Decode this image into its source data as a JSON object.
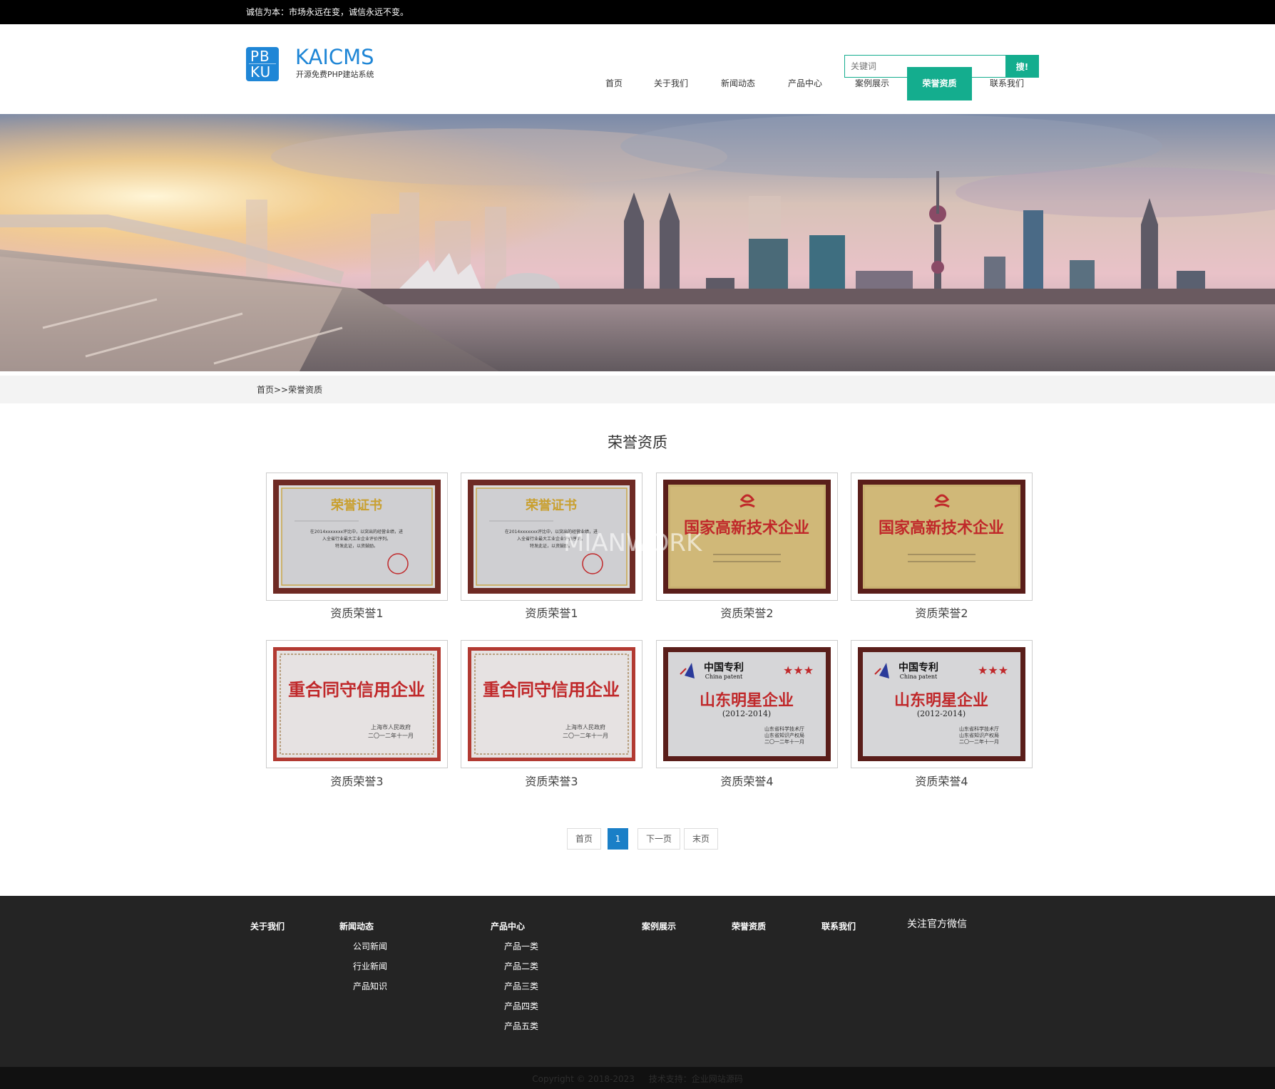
{
  "topbar": {
    "slogan": "诚信为本：市场永远在变，诚信永远不变。"
  },
  "logo": {
    "mark_line1": "PB",
    "mark_line2": "KU",
    "name": "KAICMS",
    "tagline": "开源免费PHP建站系统",
    "brand_color": "#1f86d6"
  },
  "search": {
    "placeholder": "关键词",
    "button_label": "搜!"
  },
  "nav": {
    "items": [
      {
        "label": "首页",
        "active": false
      },
      {
        "label": "关于我们",
        "active": false
      },
      {
        "label": "新闻动态",
        "active": false
      },
      {
        "label": "产品中心",
        "active": false
      },
      {
        "label": "案例展示",
        "active": false
      },
      {
        "label": "荣誉资质",
        "active": true
      },
      {
        "label": "联系我们",
        "active": false
      }
    ],
    "accent_color": "#14ad8e"
  },
  "breadcrumb": {
    "text": "首页>>荣誉资质"
  },
  "section": {
    "title": "荣誉资质"
  },
  "watermark": "MIANWORK",
  "cards": [
    {
      "caption": "资质荣誉1",
      "cert_type": "honor-certificate-icon",
      "cert_title": "荣誉证书",
      "cert_body_1": "在2014xxxxxxx评比中，以突出的经营业绩，进",
      "cert_body_2": "入全省行业最大工业企业评价序列。",
      "cert_body_3": "特发此证，以资鼓励。"
    },
    {
      "caption": "资质荣誉1",
      "cert_type": "honor-certificate-icon",
      "cert_title": "荣誉证书",
      "cert_body_1": "在2014xxxxxxx评比中，以突出的经营业绩，进",
      "cert_body_2": "入全省行业最大工业企业评价序列。",
      "cert_body_3": "特发此证，以资鼓励。"
    },
    {
      "caption": "资质荣誉2",
      "cert_type": "hightech-plaque-icon",
      "cert_title": "国家高新技术企业"
    },
    {
      "caption": "资质荣誉2",
      "cert_type": "hightech-plaque-icon",
      "cert_title": "国家高新技术企业"
    },
    {
      "caption": "资质荣誉3",
      "cert_type": "credit-plaque-icon",
      "cert_title": "重合同守信用企业",
      "cert_sign_1": "上海市人民政府",
      "cert_sign_2": "二〇一二年十一月"
    },
    {
      "caption": "资质荣誉3",
      "cert_type": "credit-plaque-icon",
      "cert_title": "重合同守信用企业",
      "cert_sign_1": "上海市人民政府",
      "cert_sign_2": "二〇一二年十一月"
    },
    {
      "caption": "资质荣誉4",
      "cert_type": "patent-plaque-icon",
      "cert_brand": "中国专利",
      "cert_brand_en": "China patent",
      "cert_title": "山东明星企业",
      "cert_years": "(2012-2014)",
      "cert_sign_1": "山东省科学技术厅",
      "cert_sign_2": "山东省知识产权局",
      "cert_sign_3": "二〇一二年十一月"
    },
    {
      "caption": "资质荣誉4",
      "cert_type": "patent-plaque-icon",
      "cert_brand": "中国专利",
      "cert_brand_en": "China patent",
      "cert_title": "山东明星企业",
      "cert_years": "(2012-2014)",
      "cert_sign_1": "山东省科学技术厅",
      "cert_sign_2": "山东省知识产权局",
      "cert_sign_3": "二〇一二年十一月"
    }
  ],
  "pagination": {
    "first": "首页",
    "current": "1",
    "next": "下一页",
    "last": "末页",
    "current_color": "#1a7fc7"
  },
  "footer": {
    "columns": [
      {
        "heading": "关于我们",
        "links": []
      },
      {
        "heading": "新闻动态",
        "links": [
          "公司新闻",
          "行业新闻",
          "产品知识"
        ]
      },
      {
        "heading": "产品中心",
        "links": [
          "产品一类",
          "产品二类",
          "产品三类",
          "产品四类",
          "产品五类"
        ]
      },
      {
        "heading": "案例展示",
        "links": []
      },
      {
        "heading": "荣誉资质",
        "links": []
      },
      {
        "heading": "联系我们",
        "links": []
      }
    ],
    "wechat_label": "关注官方微信",
    "copyright": "Copyright © 2018-2023",
    "support": "技术支持：企业网站源码"
  }
}
